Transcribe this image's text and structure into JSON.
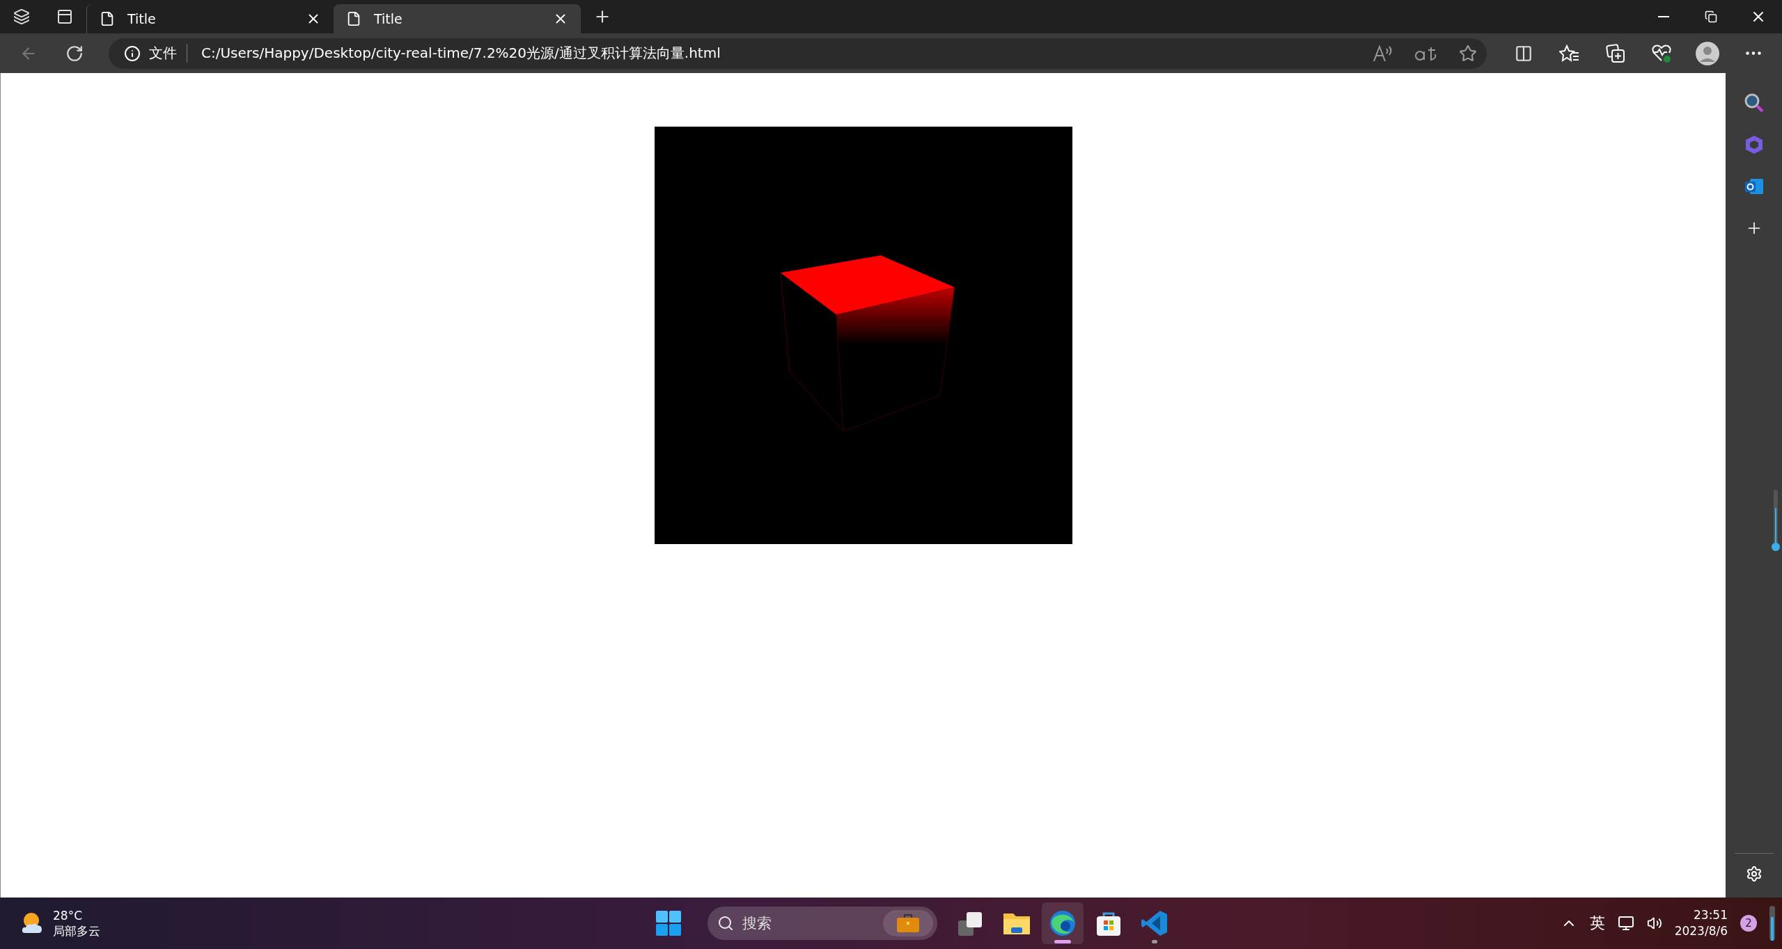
{
  "tabs": [
    {
      "title": "Title",
      "selected": false
    },
    {
      "title": "Title",
      "selected": true
    }
  ],
  "address_bar": {
    "site_label": "文件",
    "url": "C:/Users/Happy/Desktop/city-real-time/7.2%20光源/通过叉积计算法向量.html"
  },
  "taskbar": {
    "weather": {
      "temperature": "28°C",
      "condition": "局部多云"
    },
    "search": {
      "placeholder": "搜索"
    },
    "apps": [
      {
        "kind": "taskview",
        "selected": false,
        "running": false
      },
      {
        "kind": "explorer",
        "selected": false,
        "running": false
      },
      {
        "kind": "edge",
        "selected": true,
        "running": true
      },
      {
        "kind": "store",
        "selected": false,
        "running": false
      },
      {
        "kind": "vscode",
        "selected": false,
        "running": true
      }
    ],
    "input_method": "英",
    "time": "23:51",
    "date": "2023/8/6",
    "notification_count": "2"
  }
}
